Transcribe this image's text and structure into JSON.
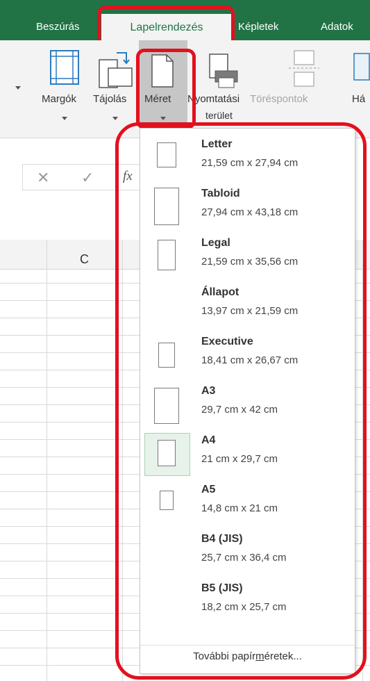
{
  "tabs": {
    "insert": "Beszúrás",
    "page_layout": "Lapelrendezés",
    "formulas": "Képletek",
    "data": "Adatok"
  },
  "ribbon": {
    "margins": "Margók",
    "orientation": "Tájolás",
    "size": "Méret",
    "print_area_line1": "Nyomtatási",
    "print_area_line2": "terület",
    "breaks": "Töréspontok",
    "background_partial": "Há"
  },
  "formula_bar": {
    "fx": "fx"
  },
  "grid": {
    "column_c": "C"
  },
  "size_menu": {
    "items": [
      {
        "name": "Letter",
        "dims": "21,59 cm x 27,94 cm"
      },
      {
        "name": "Tabloid",
        "dims": "27,94 cm x 43,18 cm"
      },
      {
        "name": "Legal",
        "dims": "21,59 cm x 35,56 cm"
      },
      {
        "name": "Állapot",
        "dims": "13,97 cm x 21,59 cm"
      },
      {
        "name": "Executive",
        "dims": "18,41 cm x 26,67 cm"
      },
      {
        "name": "A3",
        "dims": "29,7 cm x 42 cm"
      },
      {
        "name": "A4",
        "dims": "21 cm x 29,7 cm"
      },
      {
        "name": "A5",
        "dims": "14,8 cm x 21 cm"
      },
      {
        "name": "B4 (JIS)",
        "dims": "25,7 cm x 36,4 cm"
      },
      {
        "name": "B5 (JIS)",
        "dims": "18,2 cm x 25,7 cm"
      }
    ],
    "selected": "A4",
    "more_prefix": "További papír",
    "more_accel": "m",
    "more_suffix": "éretek..."
  },
  "colors": {
    "accent_green": "#217346",
    "highlight_red": "#e3101e",
    "selection_fill": "#e6f2ea"
  }
}
